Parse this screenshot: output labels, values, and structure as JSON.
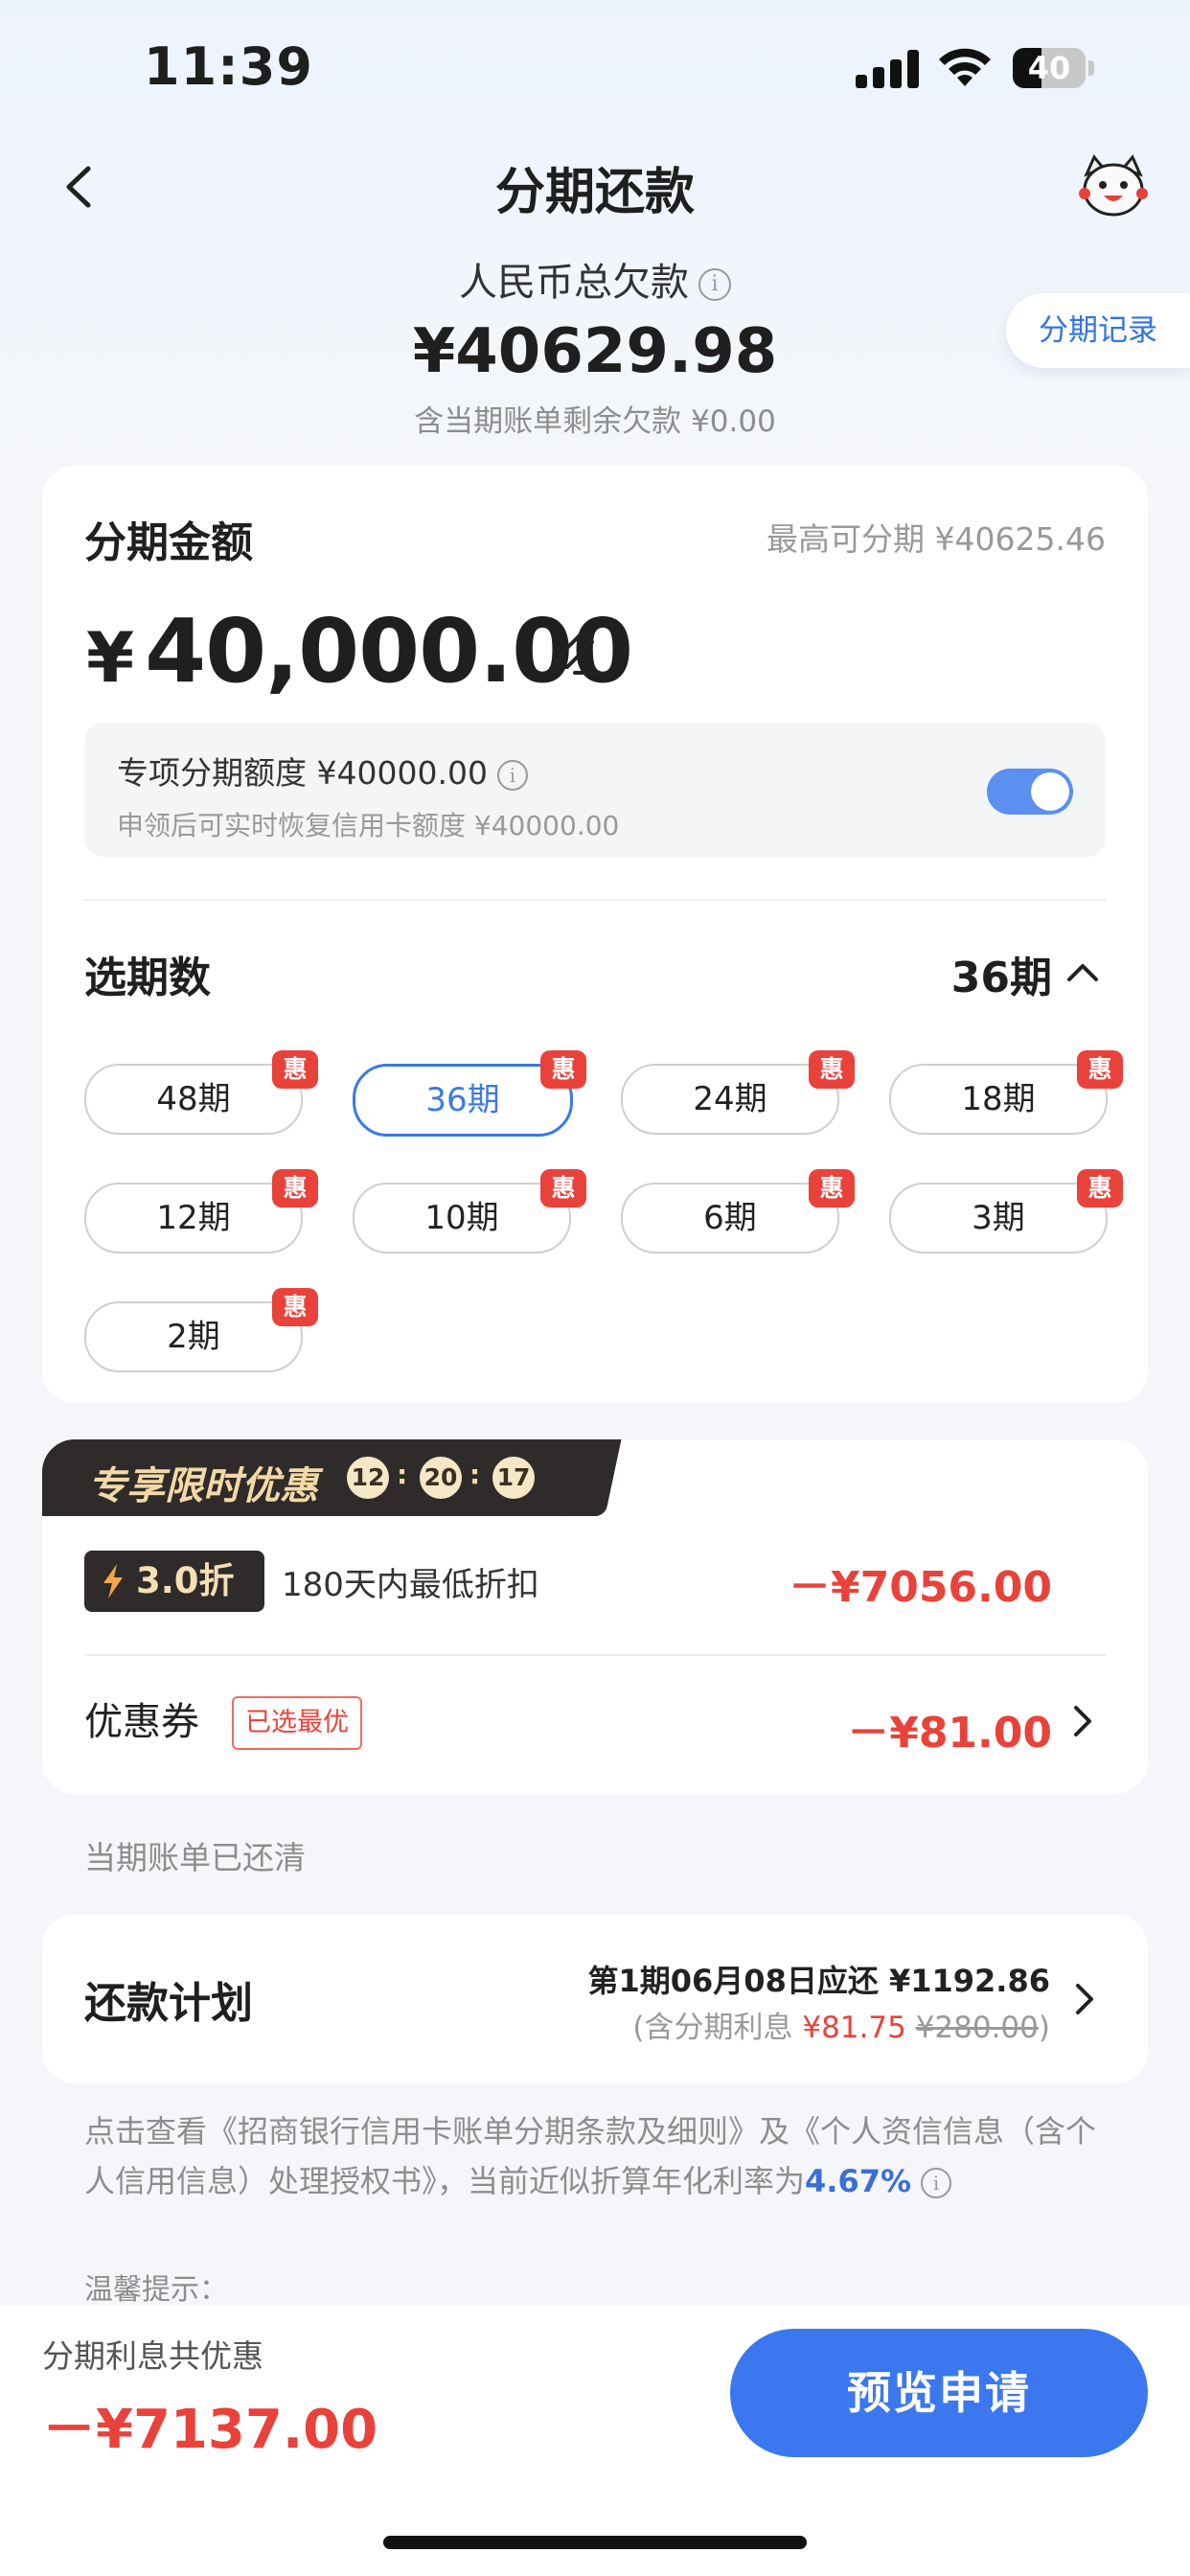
{
  "status_bar": {
    "time": "11:39",
    "battery": "40",
    "battery_level": 0.4
  },
  "header": {
    "title": "分期还款",
    "back_icon": "chevron-left-icon",
    "assistant_icon": "mascot-avatar-icon"
  },
  "summary": {
    "total_label": "人民币总欠款",
    "total_amount": "¥40629.98",
    "remaining": "含当期账单剩余欠款 ¥0.00",
    "record_button": "分期记录"
  },
  "amount_card": {
    "label": "分期金额",
    "max": "最高可分期 ¥40625.46",
    "currency": "¥",
    "amount": "40,000.00",
    "quota_title": "专项分期额度 ¥40000.00",
    "quota_sub": "申领后可实时恢复信用卡额度 ¥40000.00",
    "quota_toggle_on": true,
    "periods_label": "选期数",
    "periods_selected": "36期",
    "badge": "惠",
    "periods": [
      {
        "label": "48期",
        "selected": false
      },
      {
        "label": "36期",
        "selected": true
      },
      {
        "label": "24期",
        "selected": false
      },
      {
        "label": "18期",
        "selected": false
      },
      {
        "label": "12期",
        "selected": false
      },
      {
        "label": "10期",
        "selected": false
      },
      {
        "label": "6期",
        "selected": false
      },
      {
        "label": "3期",
        "selected": false
      },
      {
        "label": "2期",
        "selected": false
      }
    ]
  },
  "promo": {
    "title": "专享限时优惠",
    "timer": [
      "12",
      "20",
      "17"
    ],
    "discount_badge": "3.0折",
    "discount_desc": "180天内最低折扣",
    "discount_amount": "－¥7056.00",
    "coupon_label": "优惠券",
    "coupon_tag": "已选最优",
    "coupon_amount": "－¥81.00"
  },
  "settled_text": "当期账单已还清",
  "plan": {
    "label": "还款计划",
    "first": "第1期06月08日应还 ¥1192.86",
    "interest_prefix": "(含分期利息 ",
    "interest_now": "¥81.75",
    "interest_orig": "¥280.00",
    "interest_suffix": ")"
  },
  "terms": {
    "text": "点击查看《招商银行信用卡账单分期条款及细则》及《个人资信信息（含个人信用信息）处理授权书》，当前近似折算年化利率为",
    "rate": "4.67%"
  },
  "tips": "温馨提示：",
  "bottom": {
    "save_label": "分期利息共优惠",
    "save_amount": "－¥7137.00",
    "preview_button": "预览申请"
  },
  "colors": {
    "accent": "#3b78ef",
    "red": "#e9423b",
    "promo_dark": "#2e2b2a",
    "promo_gold": "#f4d9a6"
  }
}
